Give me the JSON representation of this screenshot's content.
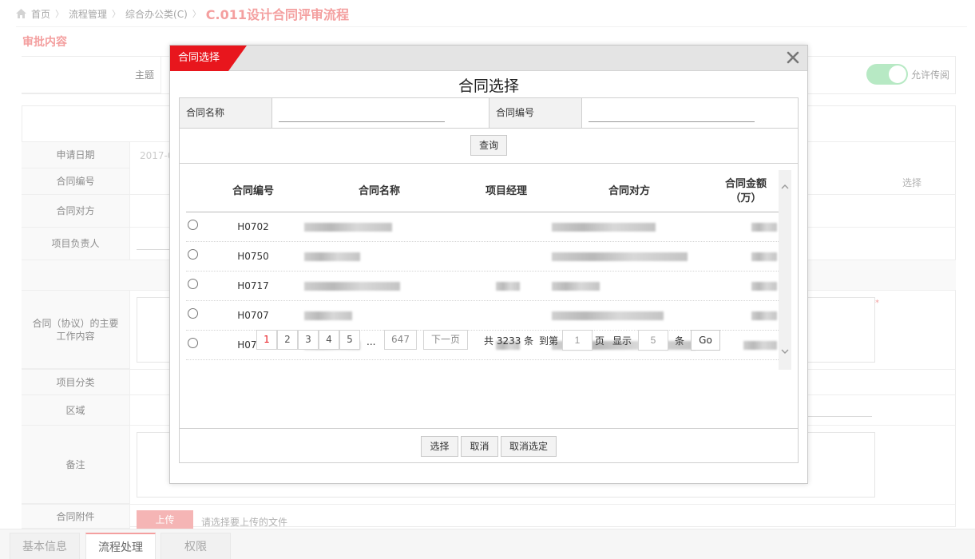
{
  "breadcrumb": {
    "home": "首页",
    "level1": "流程管理",
    "level2": "综合办公类(C)",
    "current": "C.011设计合同评审流程"
  },
  "section_title": "审批内容",
  "form": {
    "topic_label": "主题",
    "apply_date_label": "申请日期",
    "apply_date_value": "2017-0",
    "contract_no_label": "合同编号",
    "contract_no_select": "选择",
    "counterparty_label": "合同对方",
    "project_manager_label": "项目负责人",
    "main_work_label": "合同（协议）的主要工作内容",
    "project_category_label": "项目分类",
    "region_label": "区域",
    "remark_label": "备注",
    "attachment_label": "合同附件",
    "upload_button": "上传",
    "upload_hint": "请选择要上传的文件",
    "allow_forward_label": "允许传阅",
    "allow_forward_on": true
  },
  "bottom_tabs": [
    {
      "label": "基本信息",
      "active": false
    },
    {
      "label": "流程处理",
      "active": true
    },
    {
      "label": "权限",
      "active": false
    }
  ],
  "modal": {
    "tag": "合同选择",
    "title": "合同选择",
    "query": {
      "name_label": "合同名称",
      "name_value": "",
      "no_label": "合同编号",
      "no_value": "",
      "search_button": "查询"
    },
    "table": {
      "headers": [
        "合同编号",
        "合同名称",
        "项目经理",
        "合同对方",
        "合同金额（万）"
      ],
      "rows": [
        {
          "code": "H0702"
        },
        {
          "code": "H0750"
        },
        {
          "code": "H0717"
        },
        {
          "code": "H0707"
        },
        {
          "code": "H0751"
        }
      ]
    },
    "pagination": {
      "pages": [
        "1",
        "2",
        "3",
        "4",
        "5"
      ],
      "ellipsis": "...",
      "last_page": "647",
      "next_label": "下一页",
      "total_text": "共 3233 条",
      "goto_label": "到第",
      "goto_value": "1",
      "page_unit": "页",
      "show_label": "显示",
      "page_size": "5",
      "size_unit": "条",
      "go_button": "Go"
    },
    "footer": {
      "select": "选择",
      "cancel": "取消",
      "deselect": "取消选定"
    }
  },
  "colors": {
    "accent": "#f07f7f",
    "modal_red": "#e8161d",
    "toggle_green": "#9fe2b1"
  },
  "icons": {
    "home": "home-icon",
    "close": "close-icon",
    "scroll_up": "chevron-up-icon",
    "scroll_down": "chevron-down-icon"
  }
}
